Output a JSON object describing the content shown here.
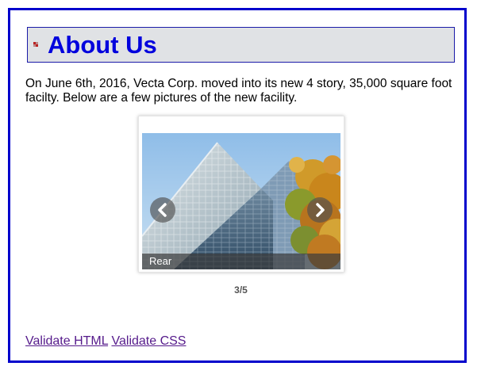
{
  "heading": {
    "title": "About Us"
  },
  "intro": {
    "text": "On June 6th, 2016, Vecta Corp. moved into its new 4 story, 35,000 square foot facilty. Below are a few pictures of the new facility."
  },
  "slider": {
    "caption": "Rear",
    "counter": "3/5"
  },
  "footer": {
    "links": [
      {
        "label": "Validate HTML"
      },
      {
        "label": "Validate CSS"
      }
    ]
  },
  "colors": {
    "border": "#0000cc",
    "heading_text": "#0000dd",
    "heading_bg": "#e0e2e5",
    "link": "#551a8b"
  },
  "icons": {
    "slider_prev": "chevron-left-icon",
    "slider_next": "chevron-right-icon",
    "heading_bullet": "square-bullet-icon"
  }
}
